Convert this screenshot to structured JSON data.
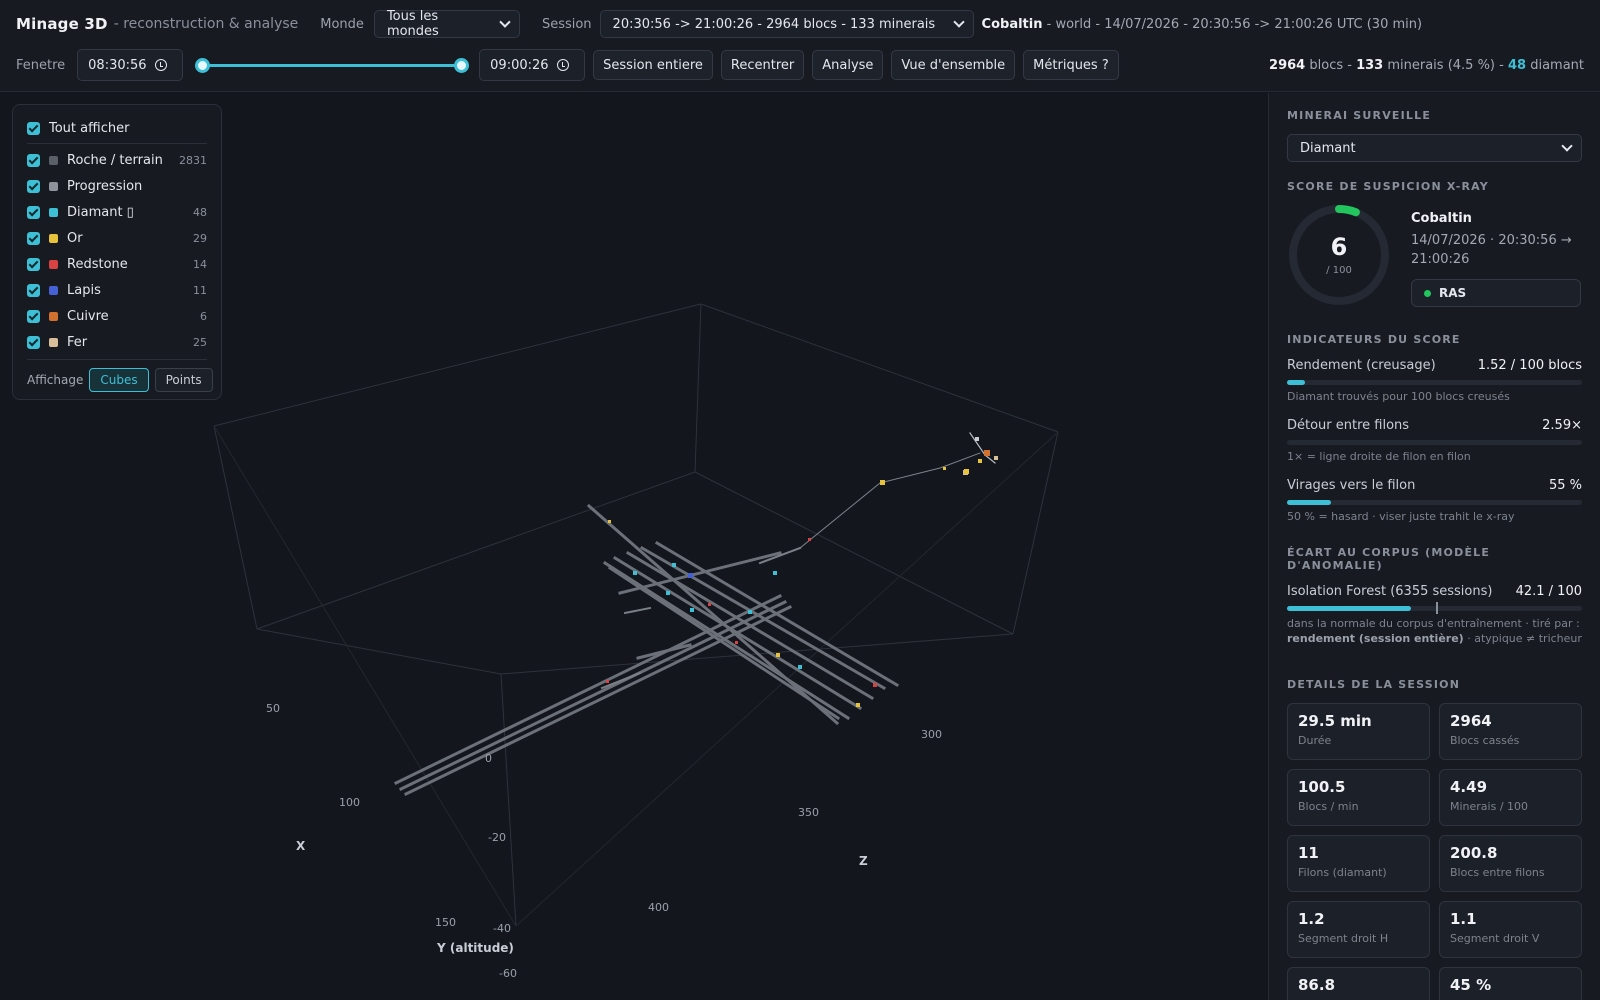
{
  "header": {
    "app_title": "Minage 3D",
    "app_subtitle": "- reconstruction & analyse",
    "world_label": "Monde",
    "world_value": "Tous les mondes",
    "session_label": "Session",
    "session_value": "20:30:56 -> 21:00:26 - 2964 blocs - 133 minerais",
    "player": "Cobaltin",
    "session_info": "- world - 14/07/2026 - 20:30:56 -> 21:00:26 UTC (30 min)",
    "window_label": "Fenetre",
    "time_start": "08:30:56",
    "time_end": "09:00:26",
    "buttons": [
      "Session entiere",
      "Recentrer",
      "Analyse",
      "Vue d'ensemble",
      "Métriques ?"
    ],
    "stats": {
      "blocks": "2964",
      "blocks_label": "blocs -",
      "ores": "133",
      "ores_label": "minerais (4.5 %) -",
      "diamonds": "48",
      "diamonds_label": "diamant"
    }
  },
  "viewport": {
    "axis_titles": {
      "x": "X",
      "y": "Y (altitude)",
      "z": "Z"
    },
    "x_ticks": [
      "50",
      "100",
      "150"
    ],
    "y_ticks": [
      "0",
      "-20",
      "-40",
      "-60"
    ],
    "z_ticks": [
      "300",
      "350",
      "400"
    ]
  },
  "legend": {
    "show_all": "Tout afficher",
    "items": [
      {
        "label": "Roche / terrain",
        "count": "2831",
        "color": "#5b6068"
      },
      {
        "label": "Progression",
        "count": "",
        "color": "#8d929b"
      },
      {
        "label": "Diamant ▯",
        "count": "48",
        "color": "#3dbfd6"
      },
      {
        "label": "Or",
        "count": "29",
        "color": "#e8c23a"
      },
      {
        "label": "Redstone",
        "count": "14",
        "color": "#d94242"
      },
      {
        "label": "Lapis",
        "count": "11",
        "color": "#4661d6"
      },
      {
        "label": "Cuivre",
        "count": "6",
        "color": "#d2702f"
      },
      {
        "label": "Fer",
        "count": "25",
        "color": "#d8bf9a"
      }
    ],
    "display_label": "Affichage",
    "mode_cubes": "Cubes",
    "mode_points": "Points"
  },
  "panel": {
    "ore_section": "Minerai surveille",
    "ore_value": "Diamant",
    "score_section": "Score de suspicion x-ray",
    "score": "6",
    "score_max": "/ 100",
    "score_fraction": 0.06,
    "score_player": "Cobaltin",
    "score_date": "14/07/2026 · 20:30:56 → 21:00:26",
    "score_badge": "RAS",
    "indicators_section": "Indicateurs du score",
    "indicators": [
      {
        "label": "Rendement (creusage)",
        "value": "1.52 / 100 blocs",
        "hint": "Diamant trouvés pour 100 blocs creusés",
        "fraction": 0.06
      },
      {
        "label": "Détour entre filons",
        "value": "2.59×",
        "hint": "1× = ligne droite de filon en filon",
        "fraction": 0.0
      },
      {
        "label": "Virages vers le filon",
        "value": "55 %",
        "hint": "50 % = hasard · viser juste trahit le x-ray",
        "fraction": 0.15
      }
    ],
    "corpus_section": "Écart au corpus (modèle d'anomalie)",
    "iso_label": "Isolation Forest (6355 sessions)",
    "iso_value": "42.1 / 100",
    "iso_fraction": 0.421,
    "iso_marker": 0.505,
    "iso_hint_1": "dans la normale du corpus d'entraînement · tiré par :",
    "iso_hint_2b": "rendement (session entière)",
    "iso_hint_2": "· atypique ≠ tricheur",
    "details_section": "Details de la session",
    "cards": [
      {
        "value": "29.5 min",
        "label": "Durée"
      },
      {
        "value": "2964",
        "label": "Blocs cassés"
      },
      {
        "value": "100.5",
        "label": "Blocs / min"
      },
      {
        "value": "4.49",
        "label": "Minerais / 100"
      },
      {
        "value": "11",
        "label": "Filons (diamant)"
      },
      {
        "value": "200.8",
        "label": "Blocs entre filons"
      },
      {
        "value": "1.2",
        "label": "Segment droit H"
      },
      {
        "value": "1.1",
        "label": "Segment droit V"
      },
      {
        "value": "86.8",
        "label": ""
      },
      {
        "value": "45 %",
        "label": ""
      }
    ]
  }
}
